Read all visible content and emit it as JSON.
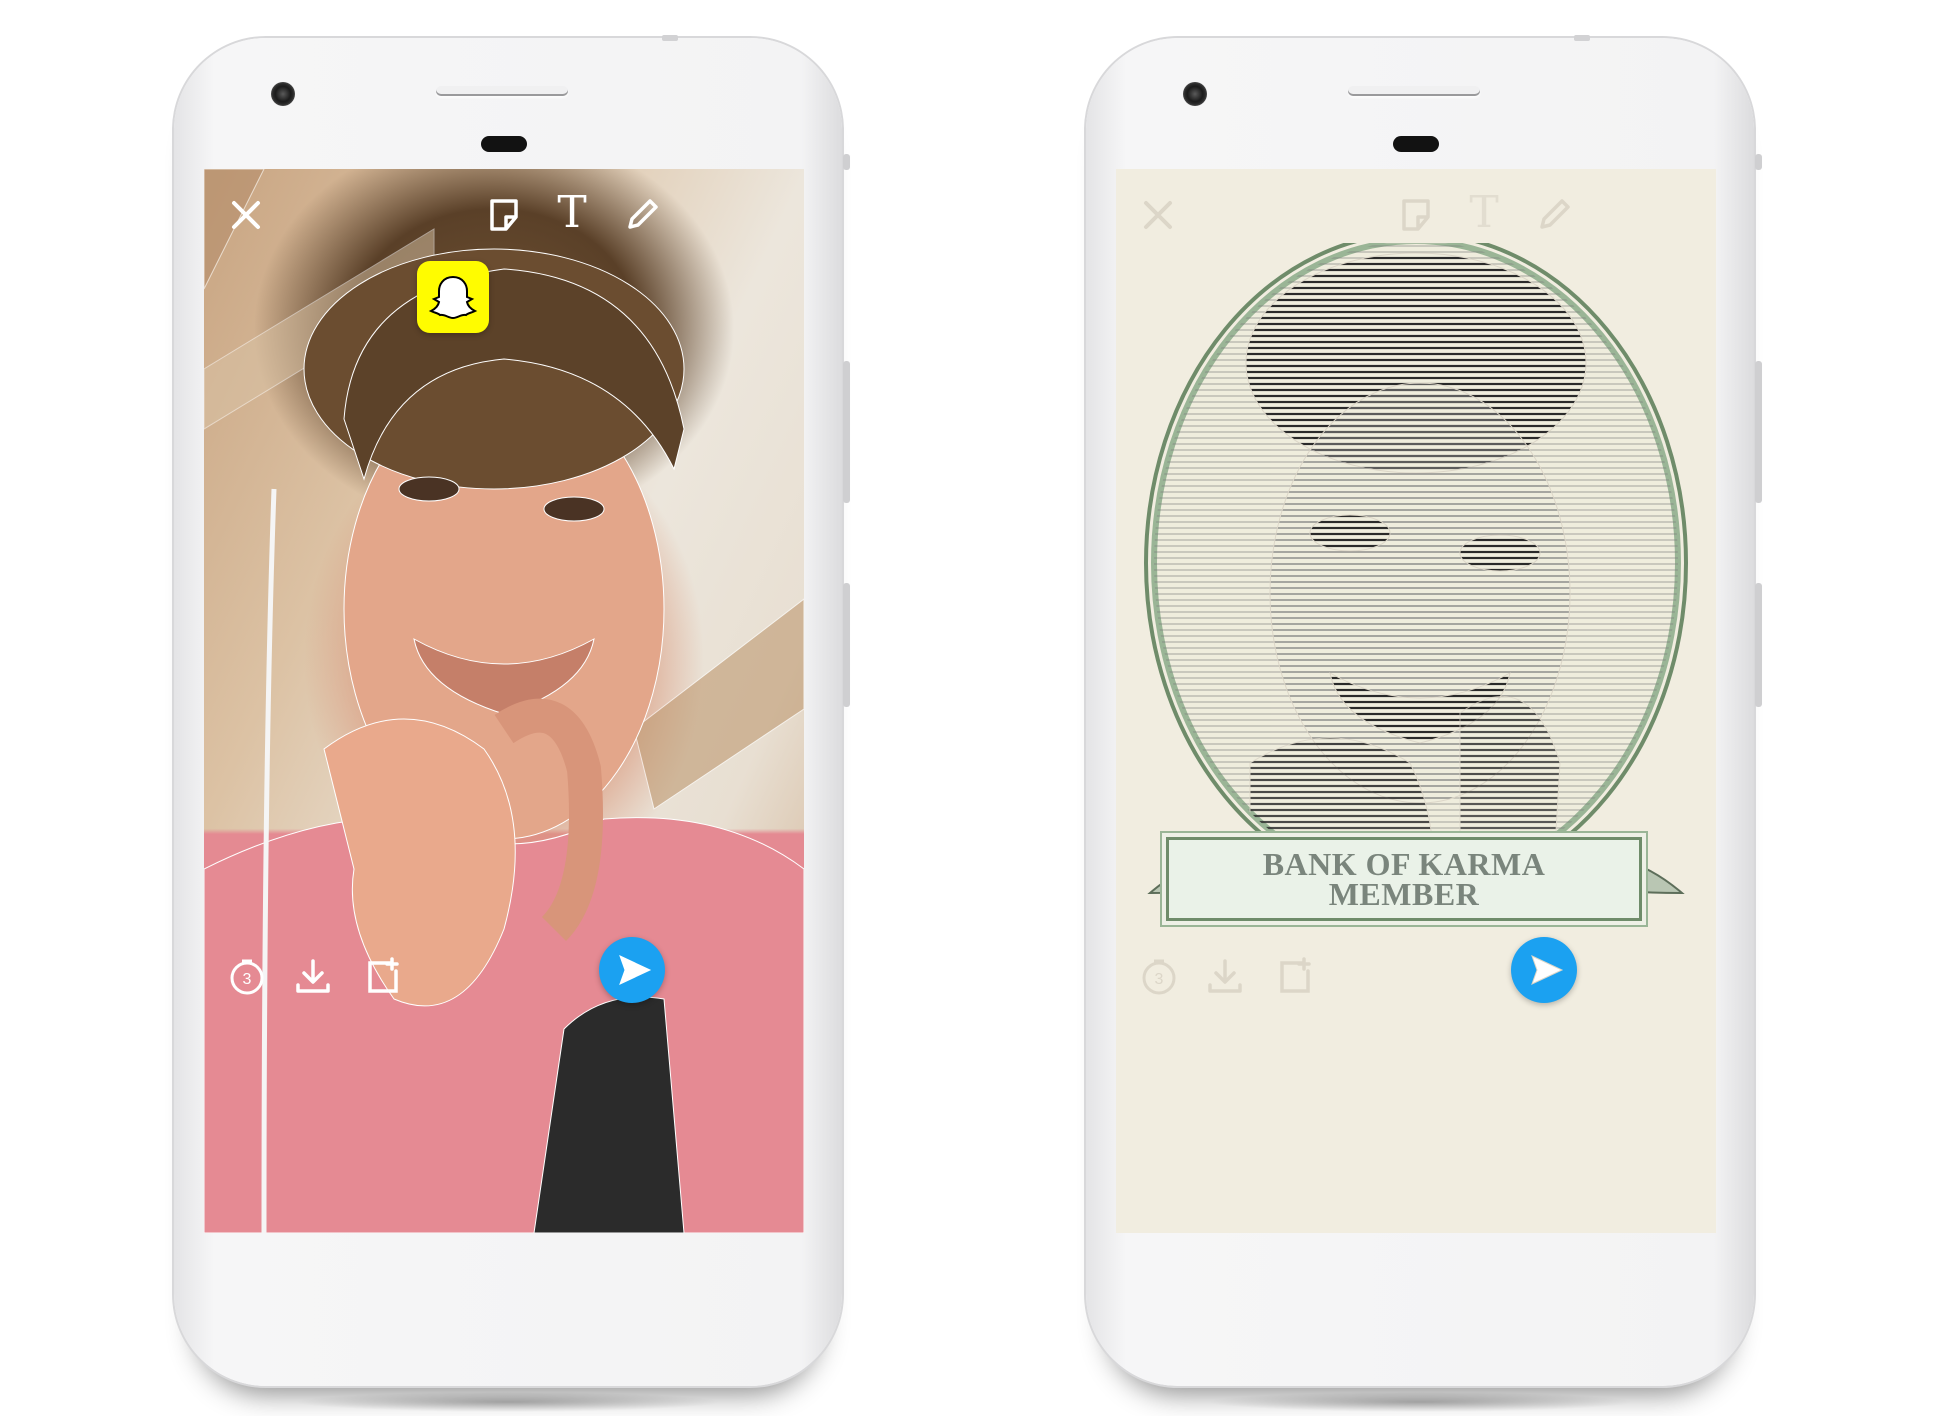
{
  "left_phone": {
    "toolbar": {
      "text_tool_glyph": "T"
    },
    "overlay": {
      "app_logo": "snapchat-ghost"
    },
    "colors": {
      "logo_yellow": "#fffc00",
      "send_blue": "#1ba1f1"
    }
  },
  "right_phone": {
    "toolbar": {
      "text_tool_glyph": "T"
    },
    "lens": {
      "banner_line1": "BANK OF KARMA",
      "banner_line2": "MEMBER"
    },
    "colors": {
      "paper": "#f1ede0",
      "ink": "#2a2a2a",
      "money_green": "#6f8c6a",
      "send_blue": "#1ba1f1"
    }
  }
}
